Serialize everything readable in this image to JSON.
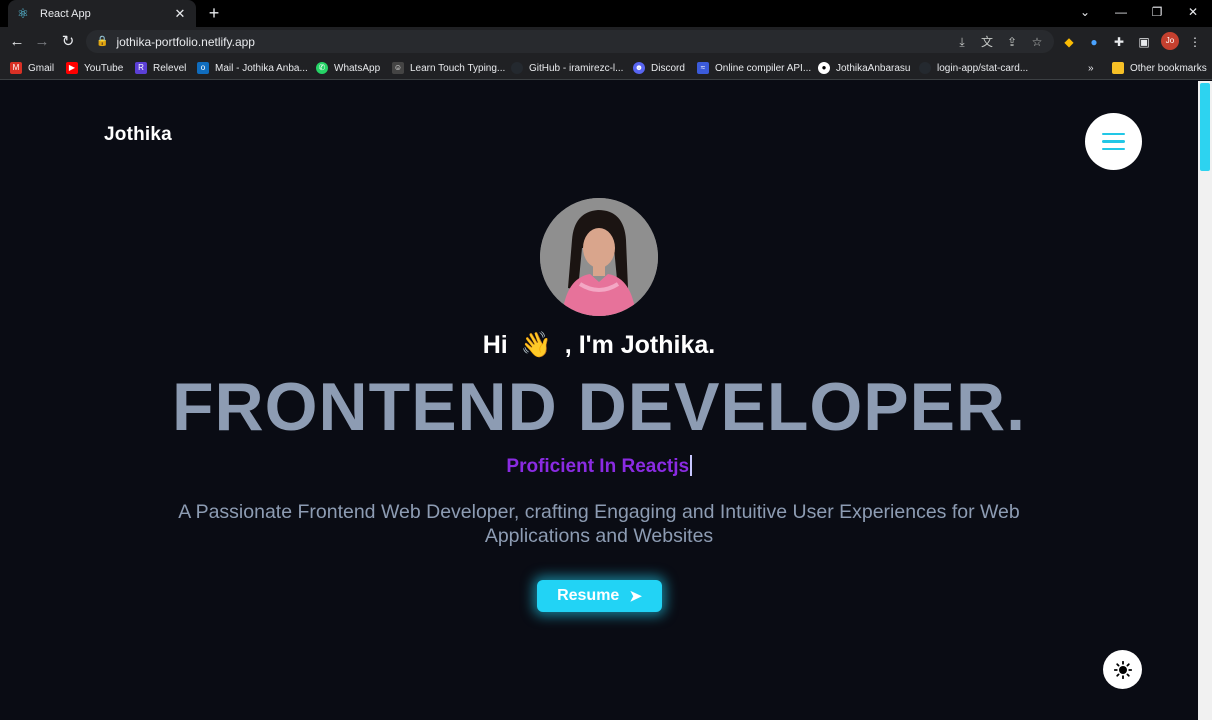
{
  "browser": {
    "tab_title": "React App",
    "url": "jothika-portfolio.netlify.app",
    "profile_initials": "Jo",
    "bookmarks": [
      {
        "label": "Gmail",
        "icon": "gmail-icon",
        "color": "#d93025"
      },
      {
        "label": "YouTube",
        "icon": "youtube-icon",
        "color": "#ff0000"
      },
      {
        "label": "Relevel",
        "icon": "relevel-icon",
        "color": "#5b3fd6"
      },
      {
        "label": "Mail - Jothika Anba...",
        "icon": "outlook-icon",
        "color": "#0f6cbd"
      },
      {
        "label": "WhatsApp",
        "icon": "whatsapp-icon",
        "color": "#25d366"
      },
      {
        "label": "Learn Touch Typing...",
        "icon": "typing-icon",
        "color": "#444444"
      },
      {
        "label": "GitHub - iramirezc-l...",
        "icon": "github-icon",
        "color": "#24292f"
      },
      {
        "label": "Discord",
        "icon": "discord-icon",
        "color": "#5865f2"
      },
      {
        "label": "Online compiler API...",
        "icon": "compiler-icon",
        "color": "#3b5bdb"
      },
      {
        "label": "JothikaAnbarasu",
        "icon": "github-icon",
        "color": "#ffffff"
      },
      {
        "label": "login-app/stat-card...",
        "icon": "github-icon",
        "color": "#24292f"
      }
    ],
    "other_bookmarks": "Other bookmarks",
    "more_chevron": "»"
  },
  "page": {
    "logo": "Jothika",
    "greeting_prefix": "Hi",
    "greeting_emoji": "👋",
    "greeting_suffix": ", I'm Jothika.",
    "headline": "FRONTEND DEVELOPER.",
    "typed_text": "Proficient In Reactjs",
    "description": "A Passionate Frontend Web Developer, crafting Engaging and Intuitive User Experiences for Web Applications and Websites",
    "resume_label": "Resume",
    "accent_color": "#22d3f5",
    "typed_color": "#8a2be2",
    "headline_color": "#8d9cb3"
  }
}
